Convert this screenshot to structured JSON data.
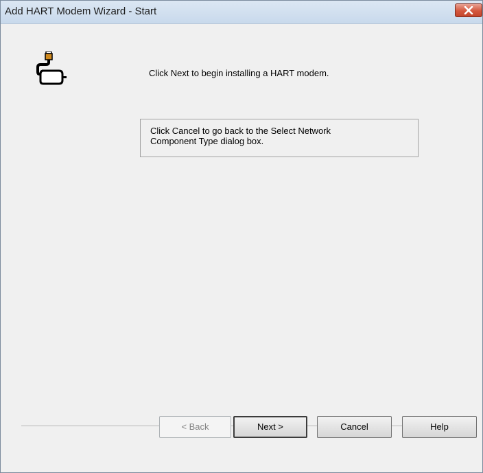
{
  "window": {
    "title": "Add HART Modem Wizard - Start"
  },
  "content": {
    "intro_text": "Click Next to begin installing a HART modem.",
    "info_lines": [
      "Click Cancel to go back to the Select Network",
      "Component Type dialog box."
    ]
  },
  "buttons": {
    "back_label": "< Back",
    "next_label": "Next >",
    "cancel_label": "Cancel",
    "help_label": "Help"
  },
  "icons": {
    "close": "close-icon",
    "modem": "hart-modem-icon"
  },
  "colors": {
    "close_button": "#c94a32",
    "dialog_background": "#f0f0f0",
    "titlebar": "#d3e1f0"
  }
}
